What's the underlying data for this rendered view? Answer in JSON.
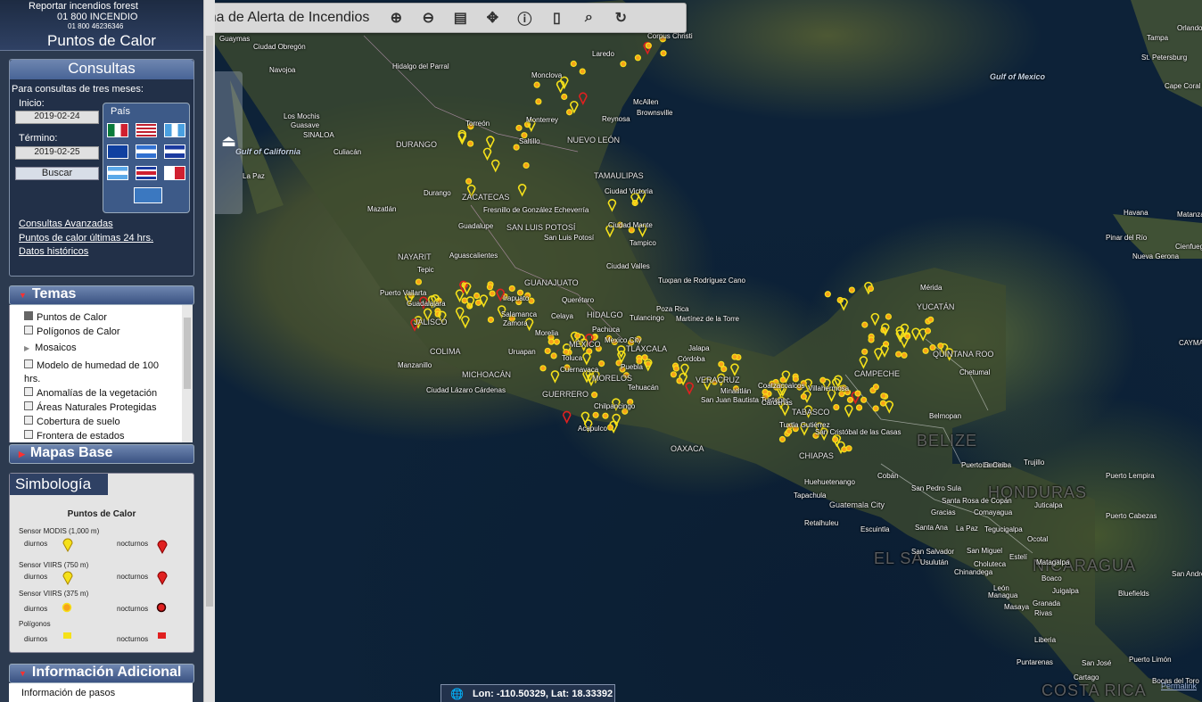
{
  "header": {
    "line1": "Reportar incendios forest",
    "line2": "01 800 INCENDIO",
    "line3": "01 800 46236346",
    "title": "Puntos de Calor"
  },
  "toolbar": {
    "title": "Sistema de Alerta de Incendios",
    "buttons": [
      "zoom-in-icon",
      "zoom-out-icon",
      "layers-icon",
      "pan-icon",
      "info-icon",
      "ruler-icon",
      "search-icon",
      "refresh-icon"
    ]
  },
  "consultas": {
    "title": "Consultas",
    "subtitle": "Para consultas de tres meses:",
    "inicio_label": "Inicio:",
    "inicio_value": "2019-02-24",
    "termino_label": "Término:",
    "termino_value": "2019-02-25",
    "buscar": "Buscar",
    "pais_label": "País",
    "links": [
      "Consultas Avanzadas",
      "Puntos de calor últimas 24 hrs.",
      "Datos históricos"
    ]
  },
  "temas": {
    "title": "Temas",
    "items": [
      {
        "label": "Puntos de Calor",
        "checked": true
      },
      {
        "label": "Polígonos de Calor",
        "checked": false
      },
      {
        "label": "Mosaicos",
        "checked": false
      },
      {
        "label": "Modelo de humedad de 100 hrs.",
        "checked": false
      },
      {
        "label": "Anomalías de la vegetación",
        "checked": false
      },
      {
        "label": "Áreas Naturales Protegidas",
        "checked": false
      },
      {
        "label": "Cobertura de suelo",
        "checked": false
      },
      {
        "label": "Frontera de estados",
        "checked": false
      }
    ]
  },
  "mapas_base": {
    "title": "Mapas Base"
  },
  "simbologia": {
    "title": "Simbología",
    "subtitle": "Puntos de Calor",
    "modis": "Sensor MODIS (1,000 m)",
    "viirs750": "Sensor VIIRS (750 m)",
    "viirs375": "Sensor VIIRS (375 m)",
    "poligonos": "Polígonos",
    "diurnos": "diurnos",
    "nocturnos": "nocturnos",
    "colors": {
      "day": "#f5e11a",
      "night": "#e02020",
      "orange": "#f7a21b"
    }
  },
  "info": {
    "title": "Información Adicional",
    "item": "Información de pasos"
  },
  "coords": {
    "text": "Lon: -110.50329, Lat: 18.33392"
  },
  "permalink": "Permalink",
  "map_labels": {
    "sea": [
      "Gulf of Mexico",
      "Gulf of California",
      "Gulf of Mexico"
    ],
    "country": [
      "EL SA",
      "NICARAGUA",
      "HONDURAS",
      "BELIZE",
      "COSTA RICA"
    ],
    "places": [
      "Guaymas",
      "Ciudad Obregón",
      "Navojoa",
      "Los Mochis",
      "Guasave",
      "SINALOA",
      "Culiacán",
      "La Paz",
      "Mazatlán",
      "DURANGO",
      "Durango",
      "Torreón",
      "Saltillo",
      "Monterrey",
      "NUEVO LEÓN",
      "McAllen",
      "Brownsville",
      "Reynosa",
      "TAMAULIPAS",
      "Ciudad Victoria",
      "ZACATECAS",
      "Fresnillo de González Echeverría",
      "Guadalupe",
      "SAN LUIS POTOSÍ",
      "San Luis Potosí",
      "Ciudad Mante",
      "Tampico",
      "NAYARIT",
      "Tepic",
      "Aguascalientes",
      "Ciudad Valles",
      "Puerto Vallarta",
      "Guadalajara",
      "JALISCO",
      "Irapuato",
      "GUANAJUATO",
      "Querétaro",
      "HIDALGO",
      "Salamanca",
      "Zamora",
      "Celaya",
      "Morelia",
      "Pachuca",
      "Tuxpan de Rodríguez Cano",
      "Poza Rica",
      "Tulancingo",
      "Martínez de la Torre",
      "COLIMA",
      "Uruapan",
      "MÉXICO",
      "Mexico City",
      "Jalapa",
      "TLAXCALA",
      "Toluca",
      "Cuernavaca",
      "Puebla",
      "Córdoba",
      "MORELOS",
      "Manzanillo",
      "MICHOACÁN",
      "Tehuacán",
      "VERACRUZ",
      "Ciudad Lázaro Cárdenas",
      "GUERRERO",
      "Chilpancingo",
      "Acapulco",
      "San Juan Bautista Tuxtepec",
      "OAXACA",
      "Minatitlán",
      "Coatzacoalcos",
      "Cárdenas",
      "Villahermosa",
      "TABASCO",
      "Tuxtla Gutiérrez",
      "San Cristóbal de las Casas",
      "CHIAPAS",
      "CAMPECHE",
      "Mérida",
      "YUCATÁN",
      "QUINTANA ROO",
      "Chetumal",
      "Belmopan",
      "Puerto Barrios",
      "La Ceiba",
      "Trujillo",
      "Puerto Lempira",
      "Cobán",
      "San Pedro Sula",
      "Huehuetenango",
      "Tapachula",
      "Guatemala City",
      "Santa Rosa de Copán",
      "Gracias",
      "Comayagua",
      "Juticalpa",
      "Puerto Cabezas",
      "Retalhuleu",
      "Escuintla",
      "Santa Ana",
      "La Paz",
      "Tegucigalpa",
      "Ocotal",
      "San Salvador",
      "Usulután",
      "San Miguel",
      "Choluteca",
      "Chinandega",
      "Estelí",
      "Matagalpa",
      "Boaco",
      "León",
      "Juigalpa",
      "Bluefields",
      "Managua",
      "Masaya",
      "Granada",
      "Rivas",
      "Liberia",
      "Puntarenas",
      "San José",
      "Puerto Limón",
      "Cartago",
      "Bocas del Toro",
      "Havana",
      "Matanzas",
      "Pinar del Río",
      "Nueva Gerona",
      "Cienfuegos",
      "Tampa",
      "Orlando",
      "St. Petersburg",
      "Cape Coral",
      "CAYMA",
      "Corpus Christi",
      "Laredo",
      "Hidalgo del Parral",
      "Monclova",
      "San Andrés",
      "Cayma"
    ]
  }
}
